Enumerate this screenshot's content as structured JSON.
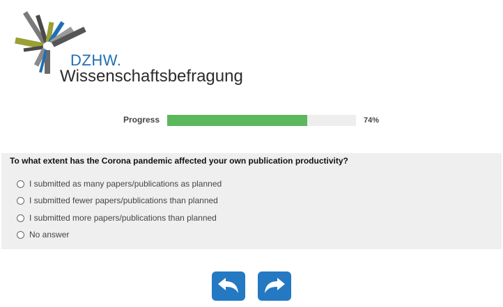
{
  "logo": {
    "short": "DZHW.",
    "name": "Wissenschaftsbefragung",
    "colors": [
      "#7a7a7a",
      "#9aa033",
      "#1f6fb5",
      "#4a4a4a"
    ]
  },
  "progress": {
    "label": "Progress",
    "value_text": "74%",
    "fraction": 0.74,
    "fill_color": "#5cb85c"
  },
  "question": {
    "text": "To what extent has the Corona pandemic affected your own publication productivity?",
    "options": [
      {
        "label": "I submitted as many papers/publications as planned"
      },
      {
        "label": "I submitted fewer papers/publications than planned"
      },
      {
        "label": "I submitted more papers/publications than planned"
      },
      {
        "label": "No answer"
      }
    ]
  },
  "nav": {
    "back_icon": "arrow-back-icon",
    "next_icon": "arrow-forward-icon",
    "color": "#2479c2"
  }
}
